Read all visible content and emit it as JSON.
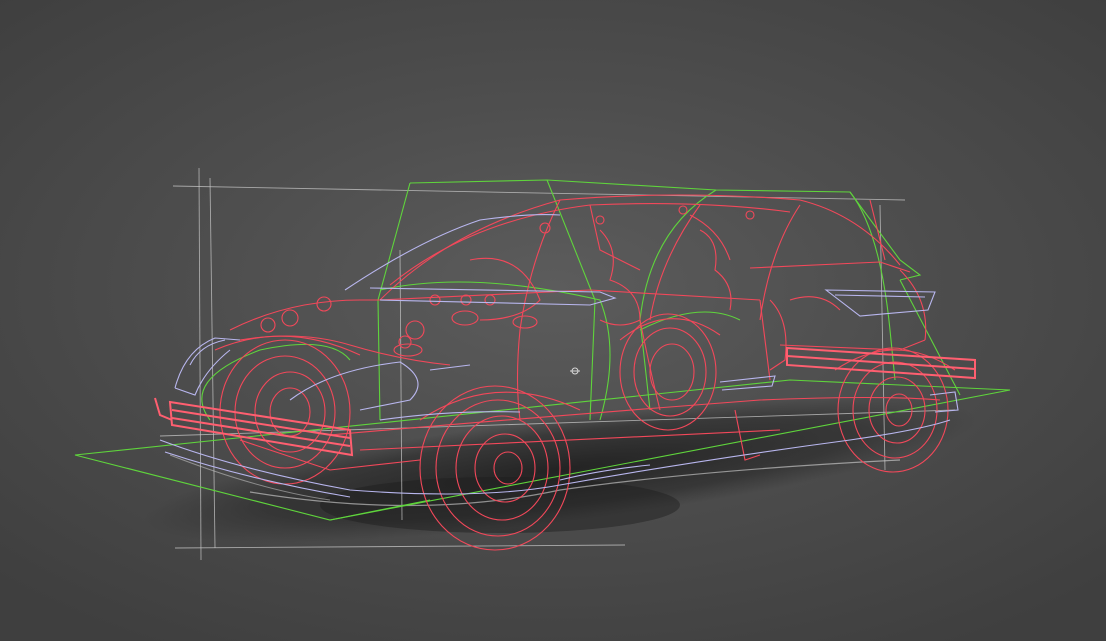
{
  "scene": {
    "background": "#4e4e4e",
    "colors": {
      "structure": "#f2485a",
      "surface": "#b8b6ee",
      "volume": "#5fd43c",
      "guides": "#c8c8c8",
      "shadow": "#2a2a2a"
    },
    "icons": [
      "pivot-gizmo-icon"
    ]
  }
}
